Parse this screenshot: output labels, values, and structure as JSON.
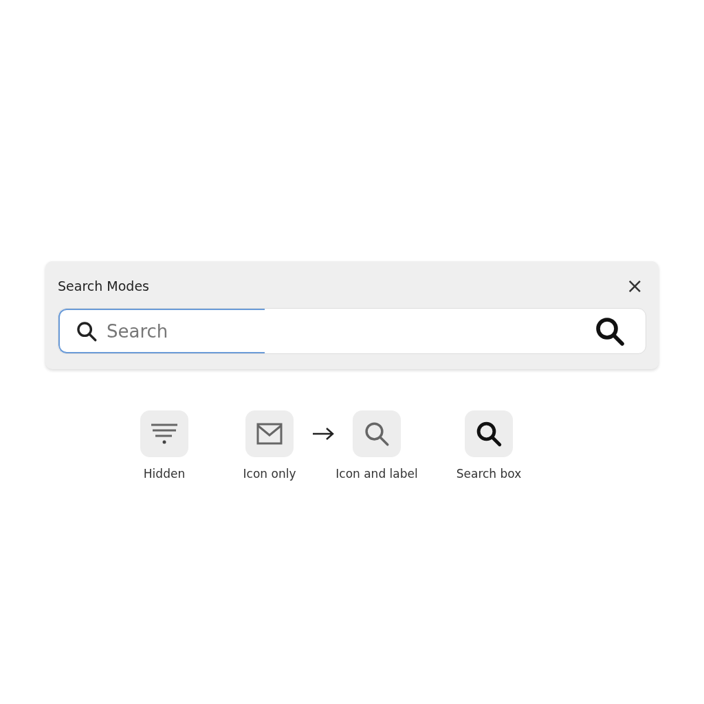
{
  "panel": {
    "title": "Search Modes",
    "close": "×"
  },
  "search": {
    "placeholder": "Search",
    "focused": true
  },
  "modes": [
    {
      "kind": "hidden",
      "label": "Hidden",
      "arrow_after": false
    },
    {
      "kind": "icon_only",
      "label": "Icon only",
      "arrow_after": true
    },
    {
      "kind": "icon_and_label",
      "label": "Icon and label",
      "arrow_after": false
    },
    {
      "kind": "search_box",
      "label": "Search box",
      "arrow_after": false
    }
  ]
}
